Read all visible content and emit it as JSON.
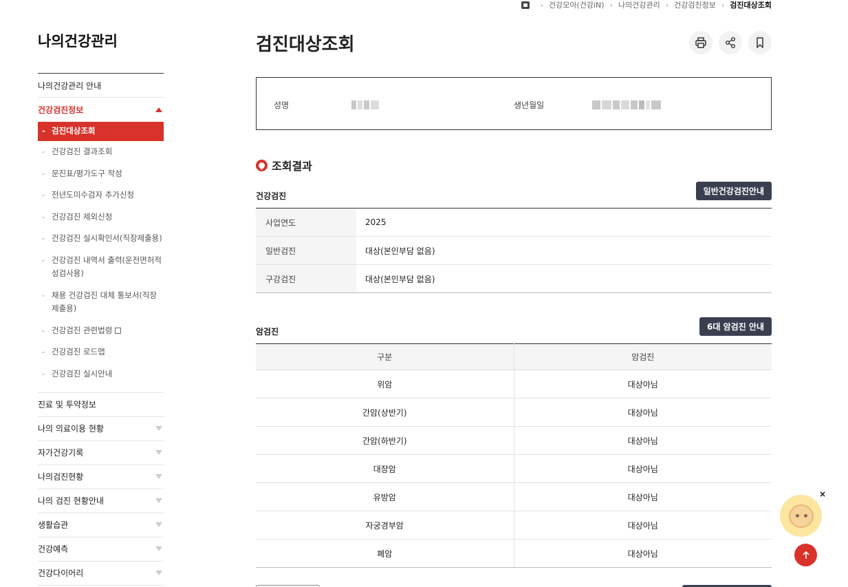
{
  "breadcrumb": {
    "items": [
      "건강모아(건강iN)",
      "나의건강관리",
      "건강검진정보"
    ],
    "current": "검진대상조회"
  },
  "sidebar": {
    "title": "나의건강관리",
    "item_guide": "나의건강관리 안내",
    "item_checkup": "건강검진정보",
    "sub_items": [
      "검진대상조회",
      "건강검진 결과조회",
      "문진표/평가도구 작성",
      "전년도미수검자 추가신청",
      "건강검진 제외신청",
      "건강검진 실시확인서(직장제출용)",
      "건강검진 내역서 출력(운전면허적성검사용)",
      "채용 건강검진 대체 통보서(직장제출용)",
      "건강검진 관련법령",
      "건강검진 로드맵",
      "건강검진 실시안내"
    ],
    "items_after": [
      "진료 및 투약정보",
      "나의 의료이용 현황",
      "자가건강기록",
      "나의검진현황",
      "나의 검진 현황안내",
      "생활습관",
      "건강예측",
      "건강다이어리"
    ]
  },
  "main": {
    "title": "검진대상조회",
    "info": {
      "name_label": "성명",
      "birth_label": "생년월일"
    },
    "section_title": "조회결과",
    "health_checkup": {
      "heading": "건강검진",
      "button": "일반건강검진안내",
      "rows": [
        {
          "label": "사업연도",
          "value": "2025"
        },
        {
          "label": "일반검진",
          "value": "대상(본인부담 없음)"
        },
        {
          "label": "구강검진",
          "value": "대상(본인부담 없음)"
        }
      ]
    },
    "cancer_checkup": {
      "heading": "암검진",
      "button": "6대 암검진 안내",
      "col1": "구분",
      "col2": "암검진",
      "rows": [
        {
          "type": "위암",
          "status": "대상아님"
        },
        {
          "type": "간암(상반기)",
          "status": "대상아님"
        },
        {
          "type": "간암(하반기)",
          "status": "대상아님"
        },
        {
          "type": "대장암",
          "status": "대상아님"
        },
        {
          "type": "유방암",
          "status": "대상아님"
        },
        {
          "type": "자궁경부암",
          "status": "대상아님"
        },
        {
          "type": "폐암",
          "status": "대상아님"
        }
      ]
    }
  },
  "floaters": {
    "close_label": "×"
  },
  "colors": {
    "accent": "#d8322a",
    "dark_button": "#3a3f50"
  },
  "icons": [
    "home-icon",
    "print-icon",
    "share-icon",
    "bookmark-icon",
    "heart-icon",
    "arrow-up-icon",
    "chatbot-icon",
    "external-link-icon"
  ]
}
